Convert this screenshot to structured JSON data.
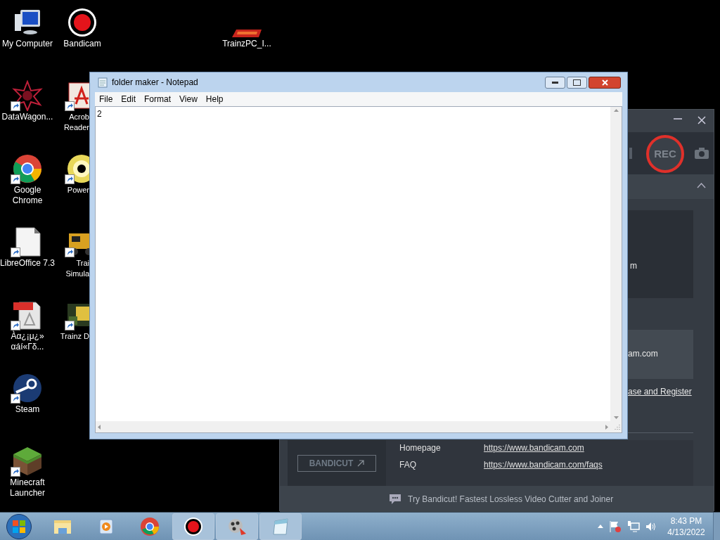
{
  "desktop_icons": [
    {
      "label": "My Computer",
      "kind": "computer",
      "shortcut": false
    },
    {
      "label": "DataWagon...",
      "kind": "star",
      "shortcut": true
    },
    {
      "label": "Google Chrome",
      "kind": "chrome",
      "shortcut": true
    },
    {
      "label": "LibreOffice 7.3",
      "kind": "document",
      "shortcut": true
    },
    {
      "label": "Àα¿¡μ¿» αáí«Γδ...",
      "kind": "pdf",
      "shortcut": true
    },
    {
      "label": "Steam",
      "kind": "steam",
      "shortcut": true
    },
    {
      "label": "Minecraft Launcher",
      "kind": "grass-block",
      "shortcut": true
    },
    {
      "label": "Bandicam",
      "kind": "record",
      "shortcut": false
    },
    {
      "label": "Acrob\nReader",
      "kind": "acrobat",
      "shortcut": true
    },
    {
      "label": "Power",
      "kind": "disc",
      "shortcut": true
    },
    {
      "label": "Trai\nSimula",
      "kind": "locomotive",
      "shortcut": true
    },
    {
      "label": "Trainz D",
      "kind": "scene",
      "shortcut": true
    },
    {
      "label": "TrainzPC_I...",
      "kind": "wordmark",
      "shortcut": false
    }
  ],
  "bandicam_window": {
    "rec_label": "REC",
    "cut_texts": [
      {
        "text": "m",
        "kind": "plain"
      },
      {
        "text": "am.com",
        "kind": "plain"
      },
      {
        "text": "ase and Register",
        "kind": "link"
      }
    ],
    "links": [
      {
        "label": "Homepage",
        "url": "https://www.bandicam.com"
      },
      {
        "label": "FAQ",
        "url": "https://www.bandicam.com/faqs"
      }
    ],
    "bandicut_button": "BANDICUT",
    "footer": "Try Bandicut! Fastest Lossless Video Cutter and Joiner"
  },
  "notepad": {
    "title": "folder maker - Notepad",
    "menu": [
      "File",
      "Edit",
      "Format",
      "View",
      "Help"
    ],
    "text": "2"
  },
  "taskbar": {
    "items": [
      {
        "kind": "folder",
        "running": false
      },
      {
        "kind": "media-player",
        "running": false
      },
      {
        "kind": "chrome",
        "running": false
      },
      {
        "kind": "record",
        "running": true
      },
      {
        "kind": "film-reel",
        "running": true
      },
      {
        "kind": "notepad",
        "running": true
      }
    ],
    "time": "8:43 PM",
    "date": "4/13/2022"
  }
}
